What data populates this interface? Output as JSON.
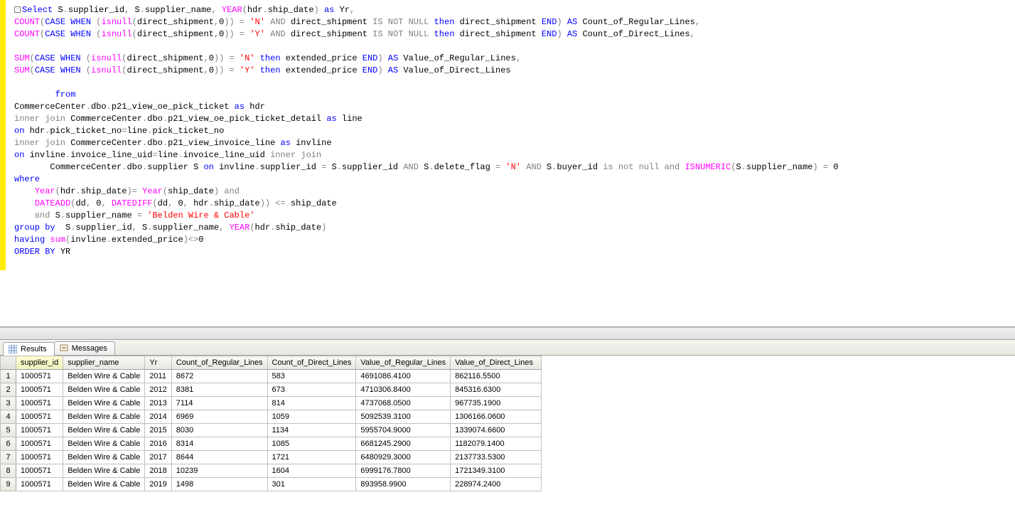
{
  "sql_tokens": [
    [
      {
        "c": "collapse",
        "t": "-"
      },
      {
        "c": "kw-blue",
        "t": "Select"
      },
      {
        "c": "kw-black",
        "t": " S"
      },
      {
        "c": "kw-gray",
        "t": "."
      },
      {
        "c": "kw-black",
        "t": "supplier_id"
      },
      {
        "c": "kw-gray",
        "t": ","
      },
      {
        "c": "kw-black",
        "t": " S"
      },
      {
        "c": "kw-gray",
        "t": "."
      },
      {
        "c": "kw-black",
        "t": "supplier_name"
      },
      {
        "c": "kw-gray",
        "t": ","
      },
      {
        "c": "kw-black",
        "t": " "
      },
      {
        "c": "kw-pink",
        "t": "YEAR"
      },
      {
        "c": "kw-gray",
        "t": "("
      },
      {
        "c": "kw-black",
        "t": "hdr"
      },
      {
        "c": "kw-gray",
        "t": "."
      },
      {
        "c": "kw-black",
        "t": "ship_date"
      },
      {
        "c": "kw-gray",
        "t": ")"
      },
      {
        "c": "kw-black",
        "t": " "
      },
      {
        "c": "kw-blue",
        "t": "as"
      },
      {
        "c": "kw-black",
        "t": " Yr"
      },
      {
        "c": "kw-gray",
        "t": ","
      }
    ],
    [
      {
        "c": "kw-pink",
        "t": "COUNT"
      },
      {
        "c": "kw-gray",
        "t": "("
      },
      {
        "c": "kw-blue",
        "t": "CASE"
      },
      {
        "c": "kw-black",
        "t": " "
      },
      {
        "c": "kw-blue",
        "t": "WHEN"
      },
      {
        "c": "kw-black",
        "t": " "
      },
      {
        "c": "kw-gray",
        "t": "("
      },
      {
        "c": "kw-pink",
        "t": "isnull"
      },
      {
        "c": "kw-gray",
        "t": "("
      },
      {
        "c": "kw-black",
        "t": "direct_shipment"
      },
      {
        "c": "kw-gray",
        "t": ","
      },
      {
        "c": "kw-black",
        "t": "0"
      },
      {
        "c": "kw-gray",
        "t": "))"
      },
      {
        "c": "kw-black",
        "t": " "
      },
      {
        "c": "kw-gray",
        "t": "="
      },
      {
        "c": "kw-black",
        "t": " "
      },
      {
        "c": "kw-red",
        "t": "'N'"
      },
      {
        "c": "kw-black",
        "t": " "
      },
      {
        "c": "kw-gray",
        "t": "AND"
      },
      {
        "c": "kw-black",
        "t": " direct_shipment "
      },
      {
        "c": "kw-gray",
        "t": "IS NOT NULL"
      },
      {
        "c": "kw-black",
        "t": " "
      },
      {
        "c": "kw-blue",
        "t": "then"
      },
      {
        "c": "kw-black",
        "t": " direct_shipment "
      },
      {
        "c": "kw-blue",
        "t": "END"
      },
      {
        "c": "kw-gray",
        "t": ")"
      },
      {
        "c": "kw-black",
        "t": " "
      },
      {
        "c": "kw-blue",
        "t": "AS"
      },
      {
        "c": "kw-black",
        "t": " Count_of_Regular_Lines"
      },
      {
        "c": "kw-gray",
        "t": ","
      }
    ],
    [
      {
        "c": "kw-pink",
        "t": "COUNT"
      },
      {
        "c": "kw-gray",
        "t": "("
      },
      {
        "c": "kw-blue",
        "t": "CASE"
      },
      {
        "c": "kw-black",
        "t": " "
      },
      {
        "c": "kw-blue",
        "t": "WHEN"
      },
      {
        "c": "kw-black",
        "t": " "
      },
      {
        "c": "kw-gray",
        "t": "("
      },
      {
        "c": "kw-pink",
        "t": "isnull"
      },
      {
        "c": "kw-gray",
        "t": "("
      },
      {
        "c": "kw-black",
        "t": "direct_shipment"
      },
      {
        "c": "kw-gray",
        "t": ","
      },
      {
        "c": "kw-black",
        "t": "0"
      },
      {
        "c": "kw-gray",
        "t": "))"
      },
      {
        "c": "kw-black",
        "t": " "
      },
      {
        "c": "kw-gray",
        "t": "="
      },
      {
        "c": "kw-black",
        "t": " "
      },
      {
        "c": "kw-red",
        "t": "'Y'"
      },
      {
        "c": "kw-black",
        "t": " "
      },
      {
        "c": "kw-gray",
        "t": "AND"
      },
      {
        "c": "kw-black",
        "t": " direct_shipment "
      },
      {
        "c": "kw-gray",
        "t": "IS NOT NULL"
      },
      {
        "c": "kw-black",
        "t": " "
      },
      {
        "c": "kw-blue",
        "t": "then"
      },
      {
        "c": "kw-black",
        "t": " direct_shipment "
      },
      {
        "c": "kw-blue",
        "t": "END"
      },
      {
        "c": "kw-gray",
        "t": ")"
      },
      {
        "c": "kw-black",
        "t": " "
      },
      {
        "c": "kw-blue",
        "t": "AS"
      },
      {
        "c": "kw-black",
        "t": " Count_of_Direct_Lines"
      },
      {
        "c": "kw-gray",
        "t": ","
      }
    ],
    [],
    [
      {
        "c": "kw-pink",
        "t": "SUM"
      },
      {
        "c": "kw-gray",
        "t": "("
      },
      {
        "c": "kw-blue",
        "t": "CASE"
      },
      {
        "c": "kw-black",
        "t": " "
      },
      {
        "c": "kw-blue",
        "t": "WHEN"
      },
      {
        "c": "kw-black",
        "t": " "
      },
      {
        "c": "kw-gray",
        "t": "("
      },
      {
        "c": "kw-pink",
        "t": "isnull"
      },
      {
        "c": "kw-gray",
        "t": "("
      },
      {
        "c": "kw-black",
        "t": "direct_shipment"
      },
      {
        "c": "kw-gray",
        "t": ","
      },
      {
        "c": "kw-black",
        "t": "0"
      },
      {
        "c": "kw-gray",
        "t": "))"
      },
      {
        "c": "kw-black",
        "t": " "
      },
      {
        "c": "kw-gray",
        "t": "="
      },
      {
        "c": "kw-black",
        "t": " "
      },
      {
        "c": "kw-red",
        "t": "'N'"
      },
      {
        "c": "kw-black",
        "t": " "
      },
      {
        "c": "kw-blue",
        "t": "then"
      },
      {
        "c": "kw-black",
        "t": " extended_price "
      },
      {
        "c": "kw-blue",
        "t": "END"
      },
      {
        "c": "kw-gray",
        "t": ")"
      },
      {
        "c": "kw-black",
        "t": " "
      },
      {
        "c": "kw-blue",
        "t": "AS"
      },
      {
        "c": "kw-black",
        "t": " Value_of_Regular_Lines"
      },
      {
        "c": "kw-gray",
        "t": ","
      }
    ],
    [
      {
        "c": "kw-pink",
        "t": "SUM"
      },
      {
        "c": "kw-gray",
        "t": "("
      },
      {
        "c": "kw-blue",
        "t": "CASE"
      },
      {
        "c": "kw-black",
        "t": " "
      },
      {
        "c": "kw-blue",
        "t": "WHEN"
      },
      {
        "c": "kw-black",
        "t": " "
      },
      {
        "c": "kw-gray",
        "t": "("
      },
      {
        "c": "kw-pink",
        "t": "isnull"
      },
      {
        "c": "kw-gray",
        "t": "("
      },
      {
        "c": "kw-black",
        "t": "direct_shipment"
      },
      {
        "c": "kw-gray",
        "t": ","
      },
      {
        "c": "kw-black",
        "t": "0"
      },
      {
        "c": "kw-gray",
        "t": "))"
      },
      {
        "c": "kw-black",
        "t": " "
      },
      {
        "c": "kw-gray",
        "t": "="
      },
      {
        "c": "kw-black",
        "t": " "
      },
      {
        "c": "kw-red",
        "t": "'Y'"
      },
      {
        "c": "kw-black",
        "t": " "
      },
      {
        "c": "kw-blue",
        "t": "then"
      },
      {
        "c": "kw-black",
        "t": " extended_price "
      },
      {
        "c": "kw-blue",
        "t": "END"
      },
      {
        "c": "kw-gray",
        "t": ")"
      },
      {
        "c": "kw-black",
        "t": " "
      },
      {
        "c": "kw-blue",
        "t": "AS"
      },
      {
        "c": "kw-black",
        "t": " Value_of_Direct_Lines"
      }
    ],
    [],
    [
      {
        "c": "kw-black",
        "t": "        "
      },
      {
        "c": "kw-blue",
        "t": "from"
      }
    ],
    [
      {
        "c": "kw-black",
        "t": "CommerceCenter"
      },
      {
        "c": "kw-gray",
        "t": "."
      },
      {
        "c": "kw-black",
        "t": "dbo"
      },
      {
        "c": "kw-gray",
        "t": "."
      },
      {
        "c": "kw-black",
        "t": "p21_view_oe_pick_ticket "
      },
      {
        "c": "kw-blue",
        "t": "as"
      },
      {
        "c": "kw-black",
        "t": " hdr"
      }
    ],
    [
      {
        "c": "kw-gray",
        "t": "inner join"
      },
      {
        "c": "kw-black",
        "t": " CommerceCenter"
      },
      {
        "c": "kw-gray",
        "t": "."
      },
      {
        "c": "kw-black",
        "t": "dbo"
      },
      {
        "c": "kw-gray",
        "t": "."
      },
      {
        "c": "kw-black",
        "t": "p21_view_oe_pick_ticket_detail "
      },
      {
        "c": "kw-blue",
        "t": "as"
      },
      {
        "c": "kw-black",
        "t": " line"
      }
    ],
    [
      {
        "c": "kw-blue",
        "t": "on"
      },
      {
        "c": "kw-black",
        "t": " hdr"
      },
      {
        "c": "kw-gray",
        "t": "."
      },
      {
        "c": "kw-black",
        "t": "pick_ticket_no"
      },
      {
        "c": "kw-gray",
        "t": "="
      },
      {
        "c": "kw-black",
        "t": "line"
      },
      {
        "c": "kw-gray",
        "t": "."
      },
      {
        "c": "kw-black",
        "t": "pick_ticket_no"
      }
    ],
    [
      {
        "c": "kw-gray",
        "t": "inner join"
      },
      {
        "c": "kw-black",
        "t": " CommerceCenter"
      },
      {
        "c": "kw-gray",
        "t": "."
      },
      {
        "c": "kw-black",
        "t": "dbo"
      },
      {
        "c": "kw-gray",
        "t": "."
      },
      {
        "c": "kw-black",
        "t": "p21_view_invoice_line "
      },
      {
        "c": "kw-blue",
        "t": "as"
      },
      {
        "c": "kw-black",
        "t": " invline"
      }
    ],
    [
      {
        "c": "kw-blue",
        "t": "on"
      },
      {
        "c": "kw-black",
        "t": " invline"
      },
      {
        "c": "kw-gray",
        "t": "."
      },
      {
        "c": "kw-black",
        "t": "invoice_line_uid"
      },
      {
        "c": "kw-gray",
        "t": "="
      },
      {
        "c": "kw-black",
        "t": "line"
      },
      {
        "c": "kw-gray",
        "t": "."
      },
      {
        "c": "kw-black",
        "t": "invoice_line_uid "
      },
      {
        "c": "kw-gray",
        "t": "inner join"
      }
    ],
    [
      {
        "c": "kw-black",
        "t": "       CommerceCenter"
      },
      {
        "c": "kw-gray",
        "t": "."
      },
      {
        "c": "kw-black",
        "t": "dbo"
      },
      {
        "c": "kw-gray",
        "t": "."
      },
      {
        "c": "kw-black",
        "t": "supplier S "
      },
      {
        "c": "kw-blue",
        "t": "on"
      },
      {
        "c": "kw-black",
        "t": " invline"
      },
      {
        "c": "kw-gray",
        "t": "."
      },
      {
        "c": "kw-black",
        "t": "supplier_id "
      },
      {
        "c": "kw-gray",
        "t": "="
      },
      {
        "c": "kw-black",
        "t": " S"
      },
      {
        "c": "kw-gray",
        "t": "."
      },
      {
        "c": "kw-black",
        "t": "supplier_id "
      },
      {
        "c": "kw-gray",
        "t": "AND"
      },
      {
        "c": "kw-black",
        "t": " S"
      },
      {
        "c": "kw-gray",
        "t": "."
      },
      {
        "c": "kw-black",
        "t": "delete_flag "
      },
      {
        "c": "kw-gray",
        "t": "="
      },
      {
        "c": "kw-black",
        "t": " "
      },
      {
        "c": "kw-red",
        "t": "'N'"
      },
      {
        "c": "kw-black",
        "t": " "
      },
      {
        "c": "kw-gray",
        "t": "AND"
      },
      {
        "c": "kw-black",
        "t": " S"
      },
      {
        "c": "kw-gray",
        "t": "."
      },
      {
        "c": "kw-black",
        "t": "buyer_id "
      },
      {
        "c": "kw-gray",
        "t": "is not null and"
      },
      {
        "c": "kw-black",
        "t": " "
      },
      {
        "c": "kw-pink",
        "t": "ISNUMERIC"
      },
      {
        "c": "kw-gray",
        "t": "("
      },
      {
        "c": "kw-black",
        "t": "S"
      },
      {
        "c": "kw-gray",
        "t": "."
      },
      {
        "c": "kw-black",
        "t": "supplier_name"
      },
      {
        "c": "kw-gray",
        "t": ")"
      },
      {
        "c": "kw-black",
        "t": " "
      },
      {
        "c": "kw-gray",
        "t": "="
      },
      {
        "c": "kw-black",
        "t": " 0"
      }
    ],
    [
      {
        "c": "kw-blue",
        "t": "where"
      }
    ],
    [
      {
        "c": "kw-black",
        "t": "    "
      },
      {
        "c": "kw-pink",
        "t": "Year"
      },
      {
        "c": "kw-gray",
        "t": "("
      },
      {
        "c": "kw-black",
        "t": "hdr"
      },
      {
        "c": "kw-gray",
        "t": "."
      },
      {
        "c": "kw-black",
        "t": "ship_date"
      },
      {
        "c": "kw-gray",
        "t": ")="
      },
      {
        "c": "kw-black",
        "t": " "
      },
      {
        "c": "kw-pink",
        "t": "Year"
      },
      {
        "c": "kw-gray",
        "t": "("
      },
      {
        "c": "kw-black",
        "t": "ship_date"
      },
      {
        "c": "kw-gray",
        "t": ")"
      },
      {
        "c": "kw-black",
        "t": " "
      },
      {
        "c": "kw-gray",
        "t": "and"
      }
    ],
    [
      {
        "c": "kw-black",
        "t": "    "
      },
      {
        "c": "kw-pink",
        "t": "DATEADD"
      },
      {
        "c": "kw-gray",
        "t": "("
      },
      {
        "c": "kw-black",
        "t": "dd"
      },
      {
        "c": "kw-gray",
        "t": ","
      },
      {
        "c": "kw-black",
        "t": " 0"
      },
      {
        "c": "kw-gray",
        "t": ","
      },
      {
        "c": "kw-black",
        "t": " "
      },
      {
        "c": "kw-pink",
        "t": "DATEDIFF"
      },
      {
        "c": "kw-gray",
        "t": "("
      },
      {
        "c": "kw-black",
        "t": "dd"
      },
      {
        "c": "kw-gray",
        "t": ","
      },
      {
        "c": "kw-black",
        "t": " 0"
      },
      {
        "c": "kw-gray",
        "t": ","
      },
      {
        "c": "kw-black",
        "t": " hdr"
      },
      {
        "c": "kw-gray",
        "t": "."
      },
      {
        "c": "kw-black",
        "t": "ship_date"
      },
      {
        "c": "kw-gray",
        "t": "))"
      },
      {
        "c": "kw-black",
        "t": " "
      },
      {
        "c": "kw-gray",
        "t": "<="
      },
      {
        "c": "kw-black",
        "t": " ship_date"
      }
    ],
    [
      {
        "c": "kw-black",
        "t": "    "
      },
      {
        "c": "kw-gray",
        "t": "and"
      },
      {
        "c": "kw-black",
        "t": " S"
      },
      {
        "c": "kw-gray",
        "t": "."
      },
      {
        "c": "kw-black",
        "t": "supplier_name "
      },
      {
        "c": "kw-gray",
        "t": "="
      },
      {
        "c": "kw-black",
        "t": " "
      },
      {
        "c": "kw-red",
        "t": "'Belden Wire & Cable'"
      }
    ],
    [
      {
        "c": "kw-blue",
        "t": "group"
      },
      {
        "c": "kw-black",
        "t": " "
      },
      {
        "c": "kw-blue",
        "t": "by"
      },
      {
        "c": "kw-black",
        "t": "  S"
      },
      {
        "c": "kw-gray",
        "t": "."
      },
      {
        "c": "kw-black",
        "t": "supplier_id"
      },
      {
        "c": "kw-gray",
        "t": ","
      },
      {
        "c": "kw-black",
        "t": " S"
      },
      {
        "c": "kw-gray",
        "t": "."
      },
      {
        "c": "kw-black",
        "t": "supplier_name"
      },
      {
        "c": "kw-gray",
        "t": ","
      },
      {
        "c": "kw-black",
        "t": " "
      },
      {
        "c": "kw-pink",
        "t": "YEAR"
      },
      {
        "c": "kw-gray",
        "t": "("
      },
      {
        "c": "kw-black",
        "t": "hdr"
      },
      {
        "c": "kw-gray",
        "t": "."
      },
      {
        "c": "kw-black",
        "t": "ship_date"
      },
      {
        "c": "kw-gray",
        "t": ")"
      }
    ],
    [
      {
        "c": "kw-blue",
        "t": "having"
      },
      {
        "c": "kw-black",
        "t": " "
      },
      {
        "c": "kw-pink",
        "t": "sum"
      },
      {
        "c": "kw-gray",
        "t": "("
      },
      {
        "c": "kw-black",
        "t": "invline"
      },
      {
        "c": "kw-gray",
        "t": "."
      },
      {
        "c": "kw-black",
        "t": "extended_price"
      },
      {
        "c": "kw-gray",
        "t": ")<>"
      },
      {
        "c": "kw-black",
        "t": "0"
      }
    ],
    [
      {
        "c": "kw-blue",
        "t": "ORDER"
      },
      {
        "c": "kw-black",
        "t": " "
      },
      {
        "c": "kw-blue",
        "t": "BY"
      },
      {
        "c": "kw-black",
        "t": " YR"
      }
    ]
  ],
  "tabs": {
    "results": "Results",
    "messages": "Messages"
  },
  "headers": [
    "supplier_id",
    "supplier_name",
    "Yr",
    "Count_of_Regular_Lines",
    "Count_of_Direct_Lines",
    "Value_of_Regular_Lines",
    "Value_of_Direct_Lines"
  ],
  "rows": [
    [
      "1000571",
      "Belden Wire & Cable",
      "2011",
      "8672",
      "583",
      "4691086.4100",
      "862116.5500"
    ],
    [
      "1000571",
      "Belden Wire & Cable",
      "2012",
      "8381",
      "673",
      "4710306.8400",
      "845316.6300"
    ],
    [
      "1000571",
      "Belden Wire & Cable",
      "2013",
      "7114",
      "814",
      "4737068.0500",
      "967735.1900"
    ],
    [
      "1000571",
      "Belden Wire & Cable",
      "2014",
      "6969",
      "1059",
      "5092539.3100",
      "1306166.0600"
    ],
    [
      "1000571",
      "Belden Wire & Cable",
      "2015",
      "8030",
      "1134",
      "5955704.9000",
      "1339074.6600"
    ],
    [
      "1000571",
      "Belden Wire & Cable",
      "2016",
      "8314",
      "1085",
      "6681245.2900",
      "1182079.1400"
    ],
    [
      "1000571",
      "Belden Wire & Cable",
      "2017",
      "8644",
      "1721",
      "6480929.3000",
      "2137733.5300"
    ],
    [
      "1000571",
      "Belden Wire & Cable",
      "2018",
      "10239",
      "1604",
      "6999176.7800",
      "1721349.3100"
    ],
    [
      "1000571",
      "Belden Wire & Cable",
      "2019",
      "1498",
      "301",
      "893958.9900",
      "228974.2400"
    ]
  ]
}
